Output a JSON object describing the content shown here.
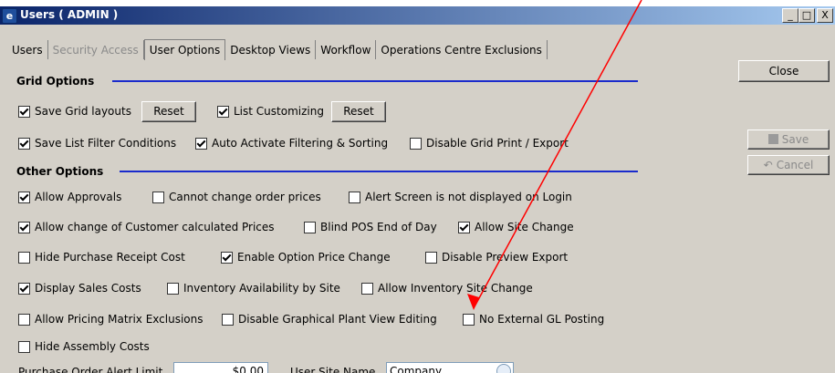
{
  "window": {
    "title": "Users ( ADMIN )"
  },
  "title_buttons": {
    "minimize": "_",
    "maximize": "□",
    "close": "X"
  },
  "tabs": [
    {
      "label": "Users",
      "state": "normal"
    },
    {
      "label": "Security Access",
      "state": "disabled"
    },
    {
      "label": "User Options",
      "state": "active"
    },
    {
      "label": "Desktop Views",
      "state": "normal"
    },
    {
      "label": "Workflow",
      "state": "normal"
    },
    {
      "label": "Operations Centre Exclusions",
      "state": "normal"
    }
  ],
  "side_buttons": {
    "close": "Close",
    "save": "Save",
    "cancel": "Cancel"
  },
  "grid_options": {
    "title": "Grid Options",
    "save_grid_layouts": {
      "label": "Save Grid layouts",
      "checked": true
    },
    "reset1": "Reset",
    "list_customizing": {
      "label": "List Customizing",
      "checked": true
    },
    "reset2": "Reset",
    "save_list_filter": {
      "label": "Save List Filter Conditions",
      "checked": true
    },
    "auto_activate": {
      "label": "Auto Activate Filtering & Sorting",
      "checked": true
    },
    "disable_grid_print": {
      "label": "Disable Grid Print / Export",
      "checked": false
    }
  },
  "other_options": {
    "title": "Other Options",
    "allow_approvals": {
      "label": "Allow Approvals",
      "checked": true
    },
    "cannot_change_prices": {
      "label": "Cannot change order prices",
      "checked": false
    },
    "alert_screen": {
      "label": "Alert Screen is not displayed on Login",
      "checked": false
    },
    "allow_change_customer_prices": {
      "label": "Allow change of Customer calculated Prices",
      "checked": true
    },
    "blind_pos": {
      "label": "Blind POS End of Day",
      "checked": false
    },
    "allow_site_change": {
      "label": "Allow Site Change",
      "checked": true
    },
    "hide_purchase_receipt": {
      "label": "Hide Purchase Receipt Cost",
      "checked": false
    },
    "enable_option_price": {
      "label": "Enable Option Price Change",
      "checked": true
    },
    "disable_preview_export": {
      "label": "Disable Preview Export",
      "checked": false
    },
    "display_sales_costs": {
      "label": "Display Sales Costs",
      "checked": true
    },
    "inventory_availability": {
      "label": "Inventory Availability by Site",
      "checked": false
    },
    "allow_inventory_site_change": {
      "label": "Allow Inventory Site Change",
      "checked": false
    },
    "allow_pricing_matrix": {
      "label": "Allow Pricing Matrix Exclusions",
      "checked": false
    },
    "disable_graphical_plant": {
      "label": "Disable Graphical Plant View Editing",
      "checked": false
    },
    "no_external_gl": {
      "label": "No External GL Posting",
      "checked": false
    },
    "hide_assembly_costs": {
      "label": "Hide Assembly Costs",
      "checked": false
    }
  },
  "bottom": {
    "po_alert_label": "Purchase Order Alert Limit",
    "po_alert_value": "$0.00",
    "user_site_label": "User Site Name",
    "user_site_value": "Company"
  },
  "annotation": {
    "arrow_color": "#ff0000"
  }
}
